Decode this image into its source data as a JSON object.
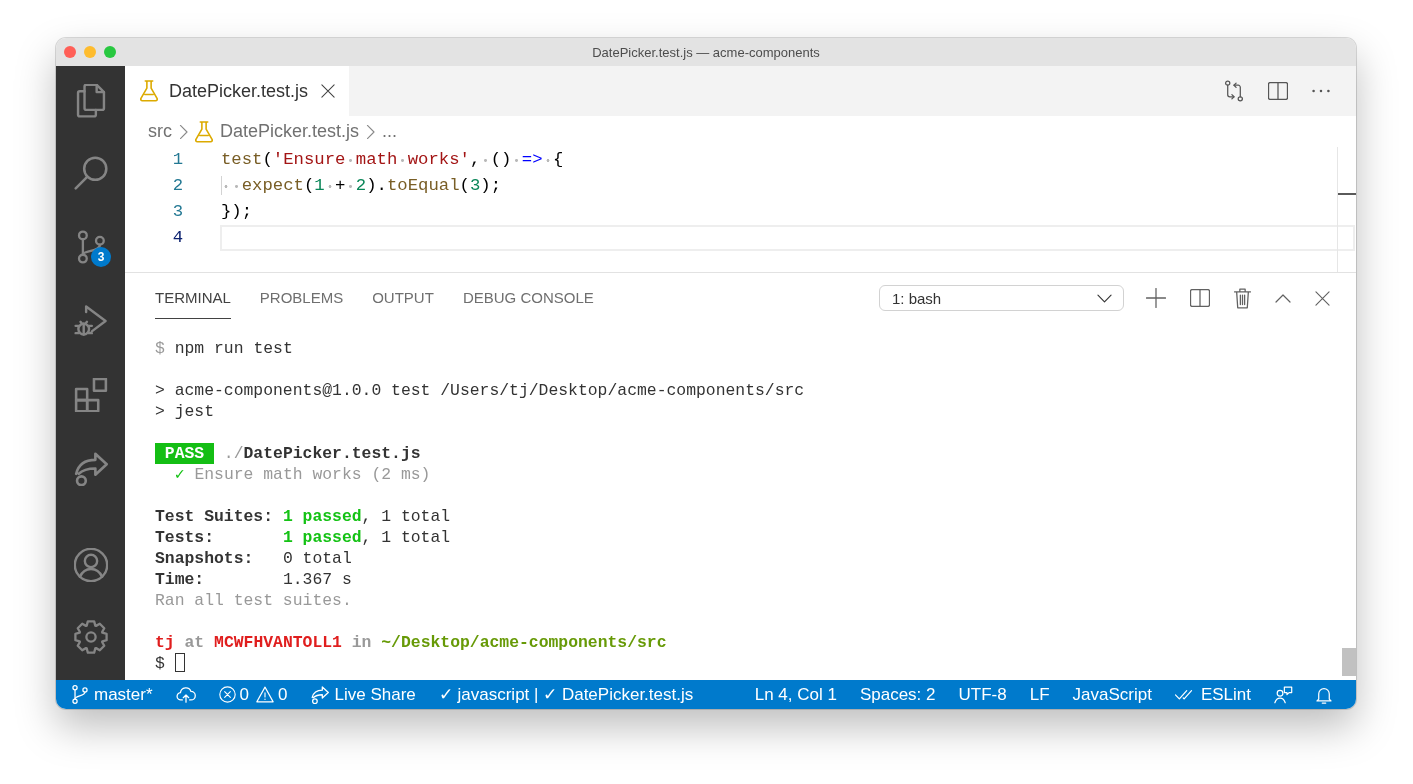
{
  "window": {
    "title": "DatePicker.test.js — acme-components"
  },
  "activity_bar": {
    "top": [
      {
        "kind": "files"
      },
      {
        "kind": "search"
      },
      {
        "kind": "source-control",
        "badge": "3"
      },
      {
        "kind": "run-debug"
      },
      {
        "kind": "extensions"
      },
      {
        "kind": "live-share"
      }
    ],
    "bottom": [
      {
        "kind": "account"
      },
      {
        "kind": "settings"
      }
    ]
  },
  "tabs": [
    {
      "label": "DatePicker.test.js",
      "selected": true
    }
  ],
  "breadcrumbs": [
    {
      "kind": "folder",
      "label": "src"
    },
    {
      "kind": "test-file",
      "label": "DatePicker.test.js"
    },
    {
      "kind": "symbol",
      "label": "..."
    }
  ],
  "editor": {
    "lines": [
      {
        "number": "1",
        "current": false,
        "tokens": [
          {
            "kind": "function",
            "text": "test"
          },
          {
            "kind": "punctuation",
            "text": "("
          },
          {
            "kind": "string",
            "text": "'Ensure math works'"
          },
          {
            "kind": "punctuation",
            "text": ", () "
          },
          {
            "kind": "keyword",
            "text": "=>"
          },
          {
            "kind": "punctuation",
            "text": " {"
          }
        ]
      },
      {
        "number": "2",
        "current": false,
        "tokens": [
          {
            "kind": "function",
            "text": "  expect"
          },
          {
            "kind": "punctuation",
            "text": "("
          },
          {
            "kind": "number",
            "text": "1"
          },
          {
            "kind": "punctuation",
            "text": " + "
          },
          {
            "kind": "number",
            "text": "2"
          },
          {
            "kind": "punctuation",
            "text": ")."
          },
          {
            "kind": "function",
            "text": "toEqual"
          },
          {
            "kind": "punctuation",
            "text": "("
          },
          {
            "kind": "number",
            "text": "3"
          },
          {
            "kind": "punctuation",
            "text": ");"
          }
        ]
      },
      {
        "number": "3",
        "current": false,
        "tokens": [
          {
            "kind": "punctuation",
            "text": "});"
          }
        ]
      },
      {
        "number": "4",
        "current": true
      }
    ]
  },
  "panel": {
    "tabs": [
      {
        "label": "TERMINAL",
        "selected": true
      },
      {
        "label": "PROBLEMS",
        "selected": false
      },
      {
        "label": "OUTPUT",
        "selected": false
      },
      {
        "label": "DEBUG CONSOLE",
        "selected": false
      }
    ],
    "terminal_selector": {
      "value": "1: bash"
    },
    "terminal": {
      "blocks": [
        {
          "lines": [
            {
              "segments": [
                {
                  "kind": "prompt",
                  "text": "$ "
                },
                {
                  "kind": "command",
                  "text": "npm run test"
                }
              ]
            }
          ]
        },
        {
          "lines": [
            {
              "segments": [
                {
                  "kind": "output",
                  "text": "> acme-components@1.0.0 test /Users/tj/Desktop/acme-components/src"
                }
              ]
            },
            {
              "segments": [
                {
                  "kind": "output",
                  "text": "> jest"
                }
              ]
            }
          ]
        },
        {
          "lines": [
            {
              "segments": [
                {
                  "kind": "badge",
                  "text": "PASS"
                },
                {
                  "kind": "directory",
                  "text": " ./"
                },
                {
                  "kind": "file",
                  "text": "DatePicker.test.js"
                }
              ]
            },
            {
              "segments": [
                {
                  "kind": "check",
                  "text": "  ✓ "
                },
                {
                  "kind": "test-name",
                  "text": "Ensure math works (2 ms)"
                }
              ]
            }
          ]
        },
        {
          "lines": [
            {
              "segments": [
                {
                  "kind": "label",
                  "text": "Test Suites: "
                },
                {
                  "kind": "passed",
                  "text": "1 passed"
                },
                {
                  "kind": "output",
                  "text": ", 1 total"
                }
              ]
            },
            {
              "segments": [
                {
                  "kind": "label",
                  "text": "Tests:       "
                },
                {
                  "kind": "passed",
                  "text": "1 passed"
                },
                {
                  "kind": "output",
                  "text": ", 1 total"
                }
              ]
            },
            {
              "segments": [
                {
                  "kind": "label",
                  "text": "Snapshots:   "
                },
                {
                  "kind": "output",
                  "text": "0 total"
                }
              ]
            },
            {
              "segments": [
                {
                  "kind": "label",
                  "text": "Time:        "
                },
                {
                  "kind": "output",
                  "text": "1.367 s"
                }
              ]
            },
            {
              "segments": [
                {
                  "kind": "note",
                  "text": "Ran all test suites."
                }
              ]
            }
          ]
        },
        {
          "lines": [
            {
              "segments": [
                {
                  "kind": "user",
                  "text": "tj"
                },
                {
                  "kind": "connector",
                  "text": " at "
                },
                {
                  "kind": "host",
                  "text": "MCWFHVANTOLL1"
                },
                {
                  "kind": "connector",
                  "text": " in "
                },
                {
                  "kind": "cwd",
                  "text": "~/Desktop/acme-components/src"
                }
              ]
            },
            {
              "segments": [
                {
                  "kind": "output",
                  "text": "$ "
                },
                {
                  "kind": "cursor"
                }
              ]
            }
          ]
        }
      ]
    }
  },
  "status_bar": {
    "left": [
      {
        "kind": "branch",
        "label": "master*"
      },
      {
        "kind": "publish"
      },
      {
        "kind": "problems",
        "errors": "0",
        "warnings": "0"
      },
      {
        "kind": "live-share",
        "label": "Live Share"
      },
      {
        "kind": "text",
        "label": "✓ javascript | ✓ DatePicker.test.js"
      }
    ],
    "right": [
      {
        "kind": "text",
        "label": "Ln 4, Col 1"
      },
      {
        "kind": "text",
        "label": "Spaces: 2"
      },
      {
        "kind": "text",
        "label": "UTF-8"
      },
      {
        "kind": "text",
        "label": "LF"
      },
      {
        "kind": "text",
        "label": "JavaScript"
      },
      {
        "kind": "eslint",
        "label": "ESLint"
      },
      {
        "kind": "feedback"
      },
      {
        "kind": "notifications"
      }
    ]
  }
}
